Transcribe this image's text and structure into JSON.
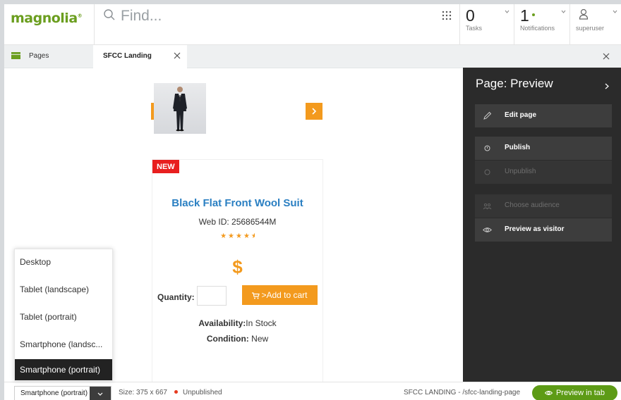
{
  "header": {
    "logo": "magnolia",
    "search": {
      "placeholder": "Find..."
    },
    "tasks": {
      "count": "0",
      "label": "Tasks"
    },
    "notifications": {
      "count": "1",
      "label": "Notifications"
    },
    "user": {
      "label": "superuser"
    }
  },
  "tabs": {
    "pages_label": "Pages",
    "active_label": "SFCC Landing"
  },
  "product": {
    "badge": "NEW",
    "title": "Black Flat Front Wool Suit",
    "web_id": "Web ID: 25686544M",
    "stars": "★★★★",
    "price": "$",
    "quantity_label": "Quantity:",
    "add_to_cart": ">Add to cart",
    "availability_label": "Availability:",
    "availability_value": "In Stock",
    "condition_label": "Condition:",
    "condition_value": "New"
  },
  "device_menu": {
    "items": [
      "Desktop",
      "Tablet (landscape)",
      "Tablet (portrait)",
      "Smartphone (landsc...",
      "Smartphone (portrait)"
    ],
    "selected": "Smartphone (portrait)"
  },
  "panel": {
    "title": "Page: Preview",
    "actions": {
      "edit": "Edit page",
      "publish": "Publish",
      "unpublish": "Unpublish",
      "choose_audience": "Choose audience",
      "preview_visitor": "Preview as visitor"
    }
  },
  "footer": {
    "device_value": "Smartphone (portrait)",
    "size": "Size: 375 x 667",
    "status": "Unpublished",
    "path": "SFCC LANDING - /sfcc-landing-page",
    "preview_tab": "Preview in tab"
  },
  "colors": {
    "brand_green": "#6b9e1f",
    "accent_orange": "#f39a1e",
    "badge_red": "#e81f1f",
    "link_blue": "#2a7fc2",
    "panel_bg": "#2b2b2b",
    "unpublished_dot": "#e63b1f"
  }
}
